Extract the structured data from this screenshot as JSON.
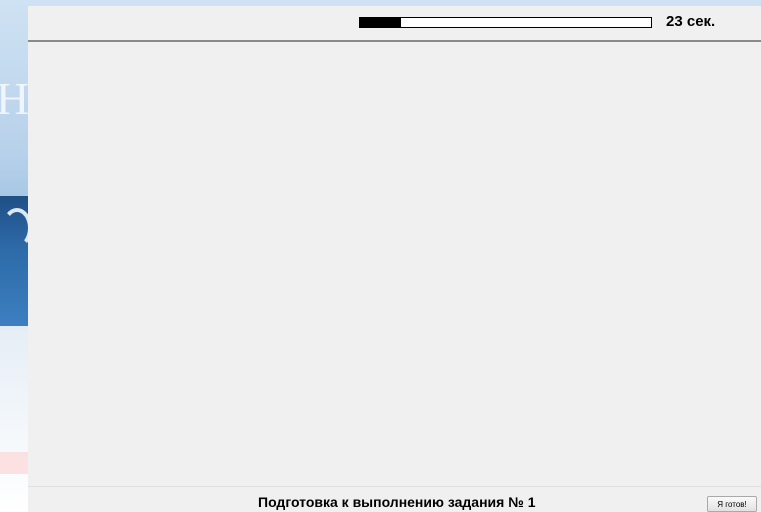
{
  "timer": {
    "progress_fraction": 0.14,
    "remaining_label": "23 сек."
  },
  "footer": {
    "status_text": "Подготовка к выполнению задания № 1",
    "ready_button_label": "Я готов!"
  },
  "colors": {
    "window_background": "#f0f0f0",
    "progress_fill": "#000000",
    "progress_track": "#ffffff",
    "divider": "#8a8a8a"
  }
}
